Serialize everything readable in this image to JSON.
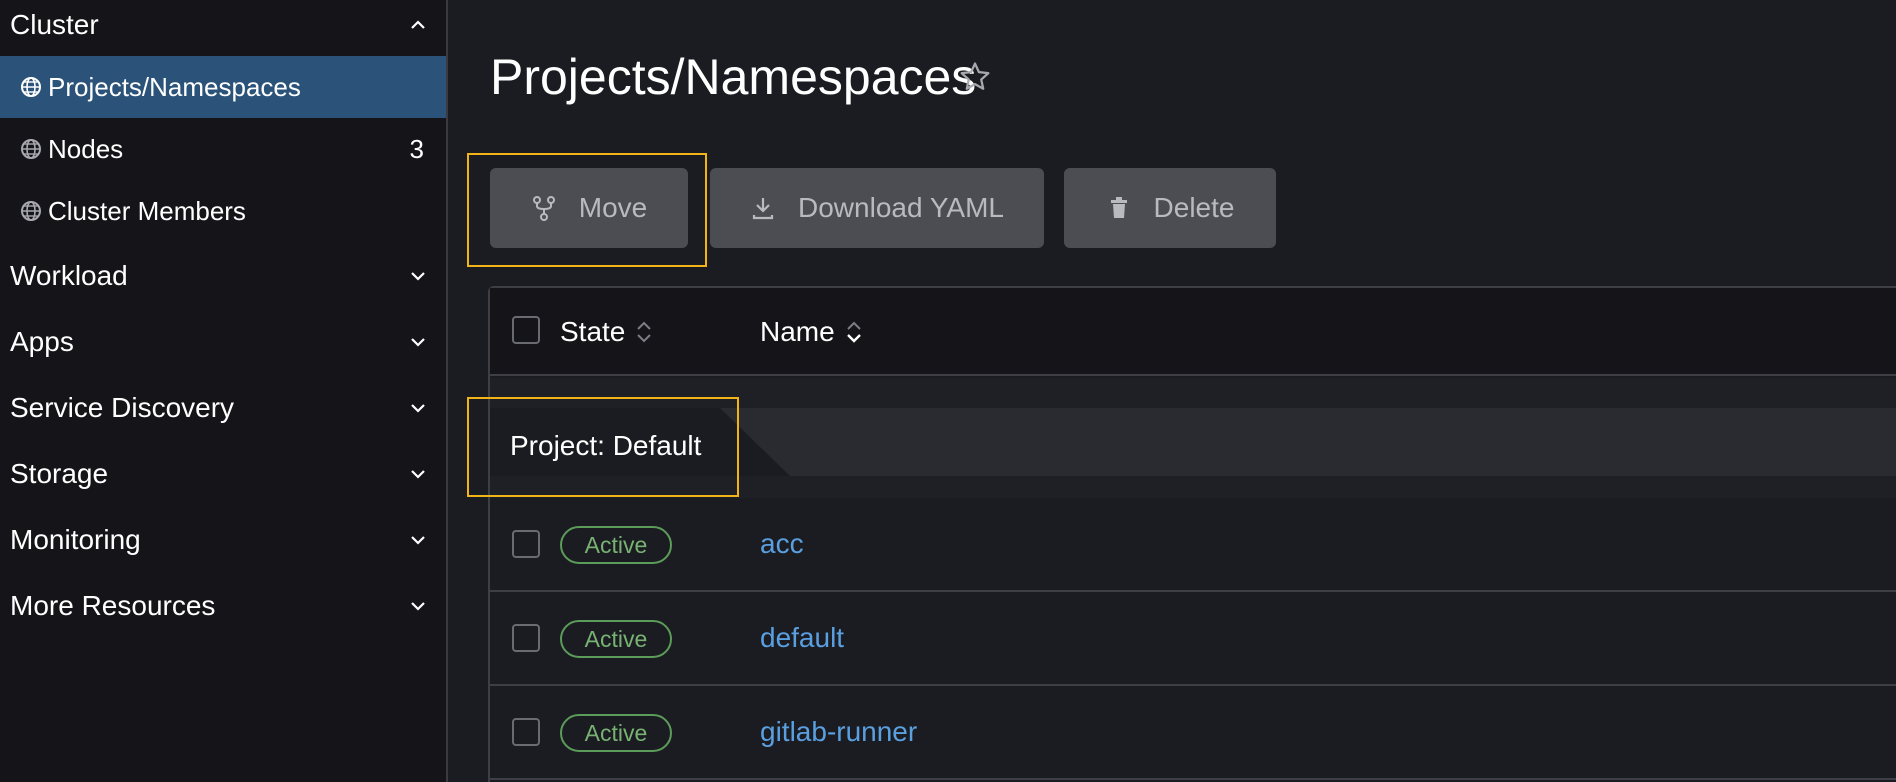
{
  "sidebar": {
    "cluster_header": "Cluster",
    "items": [
      {
        "label": "Projects/Namespaces",
        "count": ""
      },
      {
        "label": "Nodes",
        "count": "3"
      },
      {
        "label": "Cluster Members",
        "count": ""
      }
    ],
    "groups": [
      "Workload",
      "Apps",
      "Service Discovery",
      "Storage",
      "Monitoring",
      "More Resources"
    ]
  },
  "header": {
    "title": "Projects/Namespaces"
  },
  "toolbar": {
    "move_label": "Move",
    "download_label": "Download YAML",
    "delete_label": "Delete"
  },
  "table": {
    "columns": [
      "State",
      "Name"
    ],
    "group_label": "Project: Default",
    "rows": [
      {
        "state": "Active",
        "name": "acc"
      },
      {
        "state": "Active",
        "name": "default"
      },
      {
        "state": "Active",
        "name": "gitlab-runner"
      }
    ]
  },
  "colors": {
    "sidebar_active": "#2b5279",
    "highlight": "#f1b316",
    "link": "#5a9fe0",
    "active_badge": "#5c9b5a"
  }
}
